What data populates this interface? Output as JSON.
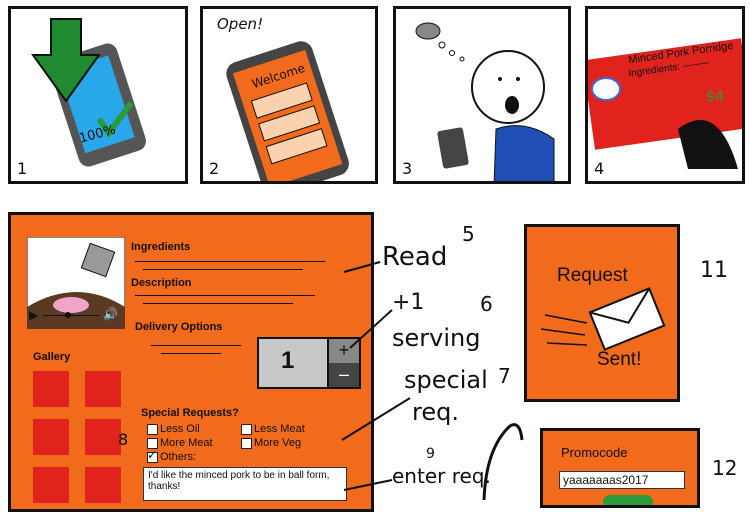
{
  "comic": {
    "panel1": {
      "number": "1",
      "percent": "100%"
    },
    "panel2": {
      "number": "2",
      "caption": "Open!",
      "screen_title": "Welcome"
    },
    "panel3": {
      "number": "3"
    },
    "panel4": {
      "number": "4",
      "dish": "Minced Pork Porridge",
      "ingredients": "Ingredients: --------",
      "price": "$4"
    },
    "panel5": {
      "ingredients": "Ingredients",
      "description": "Description",
      "delivery": "Delivery Options",
      "gallery": "Gallery",
      "quantity": "1",
      "plus": "+",
      "minus": "–",
      "special_requests": "Special Requests?",
      "options": {
        "less_oil": "Less Oil",
        "less_meat": "Less Meat",
        "more_meat": "More Meat",
        "more_veg": "More Veg",
        "others": "Others:"
      },
      "request_text": "I'd like the minced pork to be in ball form, thanks!"
    },
    "annotations": {
      "read": "Read",
      "n5": "5",
      "plus1": "+1",
      "n6": "6",
      "serving": "serving",
      "special": "special",
      "n7": "7",
      "req": "req.",
      "n8": "8",
      "n9": "9",
      "enter_req": "enter req."
    },
    "panel11": {
      "number": "11",
      "line1": "Request",
      "line2": "Sent!"
    },
    "panel12": {
      "number": "12",
      "label": "Promocode",
      "code": "yaaaaaaas2017"
    }
  },
  "colors": {
    "orange": "#f26a1b",
    "red": "#e0231d",
    "green": "#2a9a3a",
    "blue": "#2a7bd6"
  }
}
